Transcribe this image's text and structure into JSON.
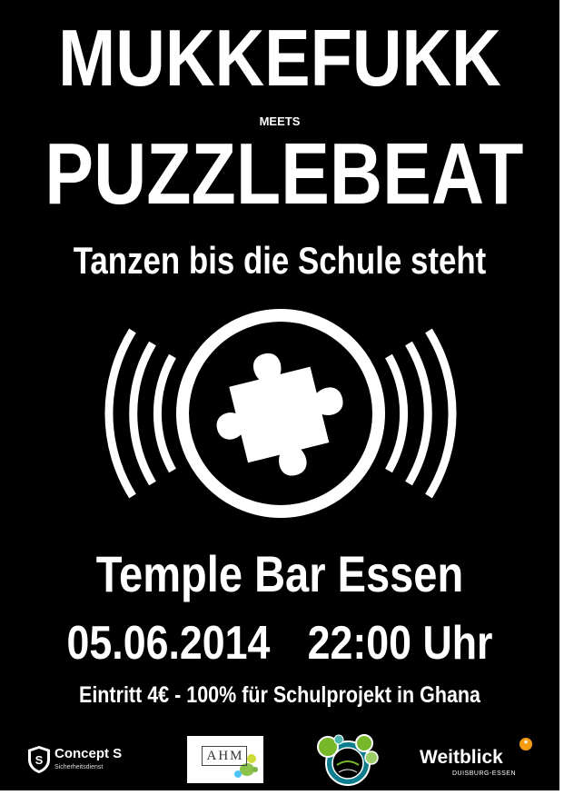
{
  "poster": {
    "title_top": "MUKKEFUKK",
    "connector": "MEETS",
    "title_bottom": "PUZZLEBEAT",
    "tagline": "Tanzen bis die Schule steht",
    "venue": "Temple Bar Essen",
    "date": "05.06.2014",
    "time": "22:00 Uhr",
    "admission": "Eintritt 4€ - 100% für Schulprojekt in Ghana"
  },
  "logo": {
    "icon": "puzzle-speaker-icon",
    "colors": {
      "background": "#000000",
      "foreground": "#ffffff"
    }
  },
  "sponsors": {
    "concept_s": {
      "name": "Concept S",
      "sub": "Sicherheitsdienst",
      "icon": "shield-s-icon"
    },
    "ahm": {
      "name": "AHM",
      "icon": "paint-splash-icon"
    },
    "bloom": {
      "icon": "bloom-circles-icon"
    },
    "weitblick": {
      "name": "Weitblick",
      "sub": "DUISBURG-ESSEN",
      "badge": "*",
      "accent": "#f39c12"
    }
  }
}
